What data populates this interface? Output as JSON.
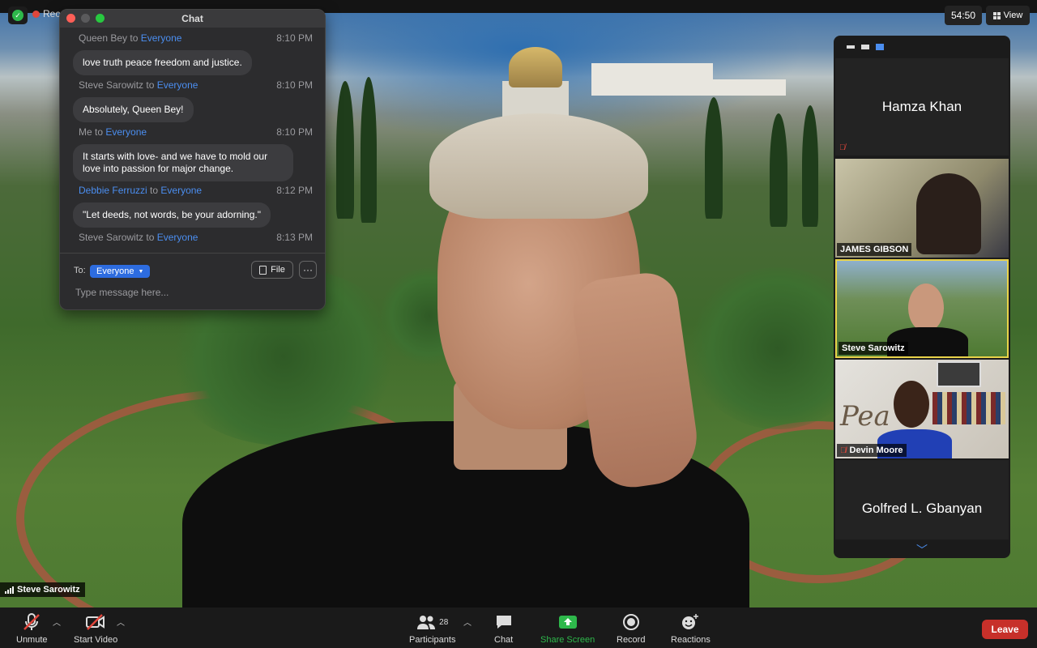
{
  "recording": {
    "label": "Rec"
  },
  "meeting": {
    "timer": "54:50",
    "view_label": "View"
  },
  "chat": {
    "title": "Chat",
    "messages": [
      {
        "sender": "Queen Bey",
        "to_word": "to",
        "recipient": "Everyone",
        "time": "8:10 PM",
        "text": "love  truth  peace  freedom  and  justice."
      },
      {
        "sender": "Steve Sarowitz",
        "to_word": "to",
        "recipient": "Everyone",
        "time": "8:10 PM",
        "text": "Absolutely, Queen Bey!"
      },
      {
        "sender": "Me",
        "to_word": "to",
        "recipient": "Everyone",
        "time": "8:10 PM",
        "text": "It starts with love- and we have to mold our love into passion for major change."
      },
      {
        "sender": "Debbie Ferruzzi",
        "to_word": "to",
        "recipient": "Everyone",
        "time": "8:12 PM",
        "text": "\"Let deeds, not words, be your adorning.\""
      },
      {
        "sender": "Steve Sarowitz",
        "to_word": "to",
        "recipient": "Everyone",
        "time": "8:13 PM",
        "text": ""
      }
    ],
    "to_label": "To:",
    "to_value": "Everyone",
    "file_label": "File",
    "more_label": "···",
    "input_placeholder": "Type message here..."
  },
  "gallery": {
    "tiles": [
      {
        "name": "Hamza Khan",
        "type": "name-only",
        "muted": true
      },
      {
        "name": "JAMES GIBSON",
        "type": "video",
        "muted": false
      },
      {
        "name": "Steve Sarowitz",
        "type": "video",
        "muted": false,
        "active": true
      },
      {
        "name": "Devin Moore",
        "type": "video",
        "muted": true
      },
      {
        "name": "Golfred L. Gbanyan",
        "type": "name-only",
        "muted": false
      }
    ]
  },
  "speaker": {
    "name": "Steve Sarowitz"
  },
  "toolbar": {
    "unmute": "Unmute",
    "start_video": "Start Video",
    "participants": "Participants",
    "participants_count": "28",
    "chat": "Chat",
    "share_screen": "Share Screen",
    "record": "Record",
    "reactions": "Reactions",
    "leave": "Leave"
  },
  "colors": {
    "accent": "#2d6cdf",
    "link": "#4b8ef0",
    "share_green": "#2eb84b",
    "leave_red": "#c7302a",
    "active_border": "#e9d34a"
  }
}
